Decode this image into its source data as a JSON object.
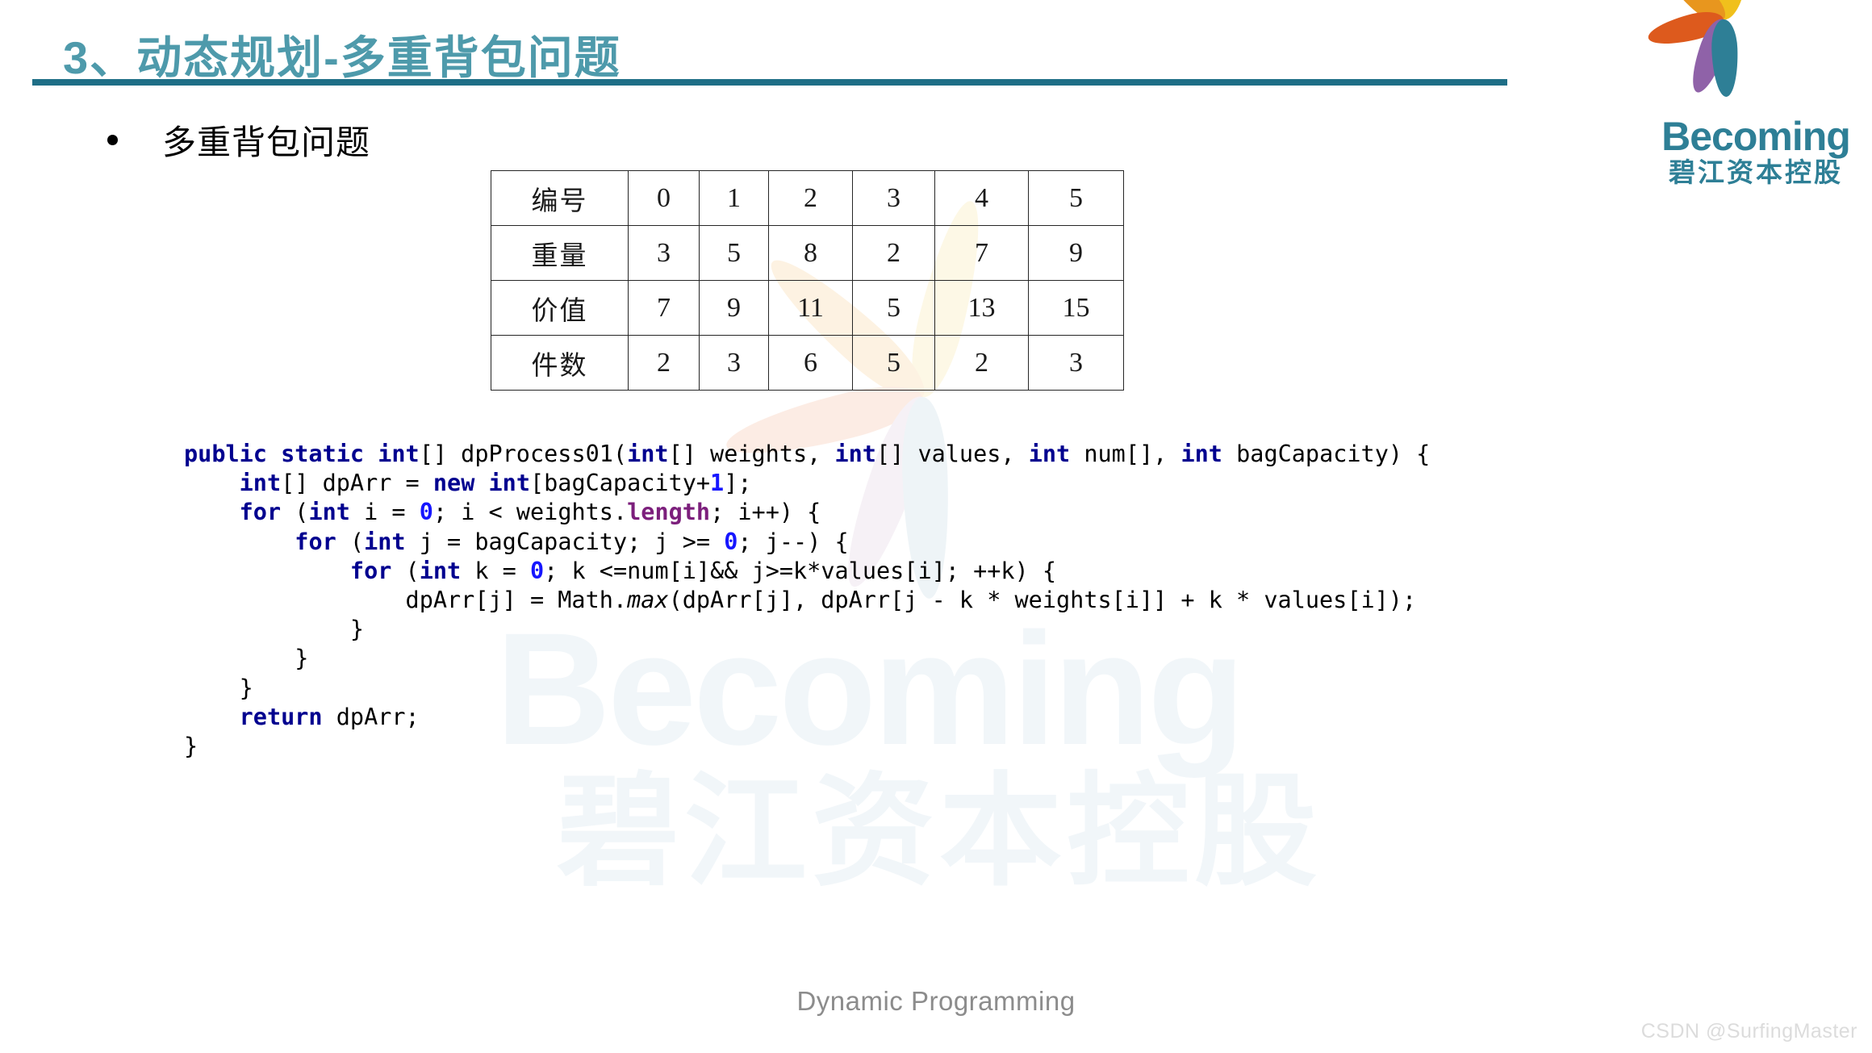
{
  "slide": {
    "title": "3、动态规划-多重背包问题",
    "title_color": "#4e9aab",
    "rule_color": "#1e6e86",
    "bullet": "多重背包问题",
    "footer_note": "Dynamic Programming",
    "csdn_watermark": "CSDN @SurfingMaster"
  },
  "logo": {
    "wordmark": "Becoming",
    "wordmark_cn": "碧江资本控股",
    "brand_color": "#2e7f96",
    "petal_colors": [
      "#f0c01c",
      "#e8961e",
      "#dd5a1d",
      "#8f62a8",
      "#2e7f96"
    ],
    "mark_name": "becoming-pinwheel-logo"
  },
  "watermark": {
    "wordmark": "Becoming",
    "wordmark_cn": "碧江资本控股",
    "tint": "#f1f6f9",
    "petal_colors": [
      "#fdf8e6",
      "#fdf2e2",
      "#fcece4",
      "#f6f1f6",
      "#eef4f7"
    ]
  },
  "table": {
    "rows": [
      {
        "label": "编号",
        "values": [
          "0",
          "1",
          "2",
          "3",
          "4",
          "5"
        ]
      },
      {
        "label": "重量",
        "values": [
          "3",
          "5",
          "8",
          "2",
          "7",
          "9"
        ]
      },
      {
        "label": "价值",
        "values": [
          "7",
          "9",
          "11",
          "5",
          "13",
          "15"
        ]
      },
      {
        "label": "件数",
        "values": [
          "2",
          "3",
          "6",
          "5",
          "2",
          "3"
        ]
      }
    ]
  },
  "code": {
    "language": "java",
    "lines": [
      "public static int[] dpProcess01(int[] weights, int[] values, int num[], int bagCapacity) {",
      "    int[] dpArr = new int[bagCapacity+1];",
      "    for (int i = 0; i < weights.length; i++) {",
      "        for (int j = bagCapacity; j >= 0; j--) {",
      "            for (int k = 0; k <=num[i]&& j>=k*values[i]; ++k) {",
      "                dpArr[j] = Math.max(dpArr[j], dpArr[j - k * weights[i]] + k * values[i]);",
      "            }",
      "        }",
      "    }",
      "    return dpArr;",
      "}"
    ],
    "html": "<span class=\"kw\">public static int</span>[] dpProcess01(<span class=\"kw\">int</span>[] weights, <span class=\"kw\">int</span>[] values, <span class=\"kw\">int</span> num[], <span class=\"kw\">int</span> bagCapacity) {\n    <span class=\"kw\">int</span>[] dpArr = <span class=\"kw\">new int</span>[bagCapacity+<span class=\"num\">1</span>];\n    <span class=\"kw\">for</span> (<span class=\"kw\">int</span> i = <span class=\"num\">0</span>; i &lt; weights.<span class=\"fld\">length</span>; i++) {\n        <span class=\"kw\">for</span> (<span class=\"kw\">int</span> j = bagCapacity; j &gt;= <span class=\"num\">0</span>; j--) {\n            <span class=\"kw\">for</span> (<span class=\"kw\">int</span> k = <span class=\"num\">0</span>; k &lt;=num[i]&amp;&amp; j&gt;=k*values[i]; ++k) {\n                dpArr[j] = Math.<span class=\"mth\">max</span>(dpArr[j], dpArr[j - k * weights[i]] + k * values[i]);\n            }\n        }\n    }\n    <span class=\"kw\">return</span> dpArr;\n}",
    "colors": {
      "keyword": "#00008f",
      "number": "#1616ff",
      "field": "#7c1f7c",
      "plain": "#000000"
    }
  }
}
